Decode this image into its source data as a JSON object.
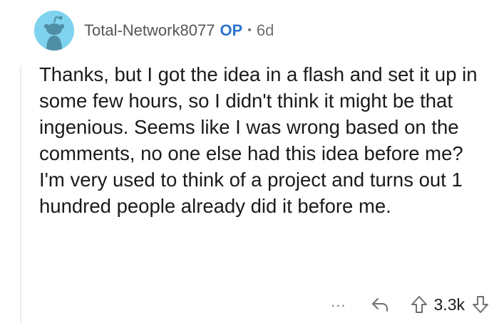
{
  "comment": {
    "author": "Total-Network8077",
    "op_badge": "OP",
    "separator": "•",
    "age": "6d",
    "body": "Thanks, but I got the idea in a flash and set it up in some few hours, so I didn't think it might be that ingenious. Seems like I was wrong based on the comments, no one else had this idea before me? I'm very used to think of a project and turns out 1 hundred people already did it before me."
  },
  "actions": {
    "more_label": "...",
    "vote_count": "3.3k"
  },
  "icons": {
    "avatar": "snoo-avatar-icon",
    "reply": "reply-arrow-icon",
    "upvote": "upvote-arrow-icon",
    "downvote": "downvote-arrow-icon"
  },
  "colors": {
    "avatar_background": "#7fd3ee",
    "op_badge": "#2f74d0",
    "meta_text": "#6f6f6f"
  }
}
